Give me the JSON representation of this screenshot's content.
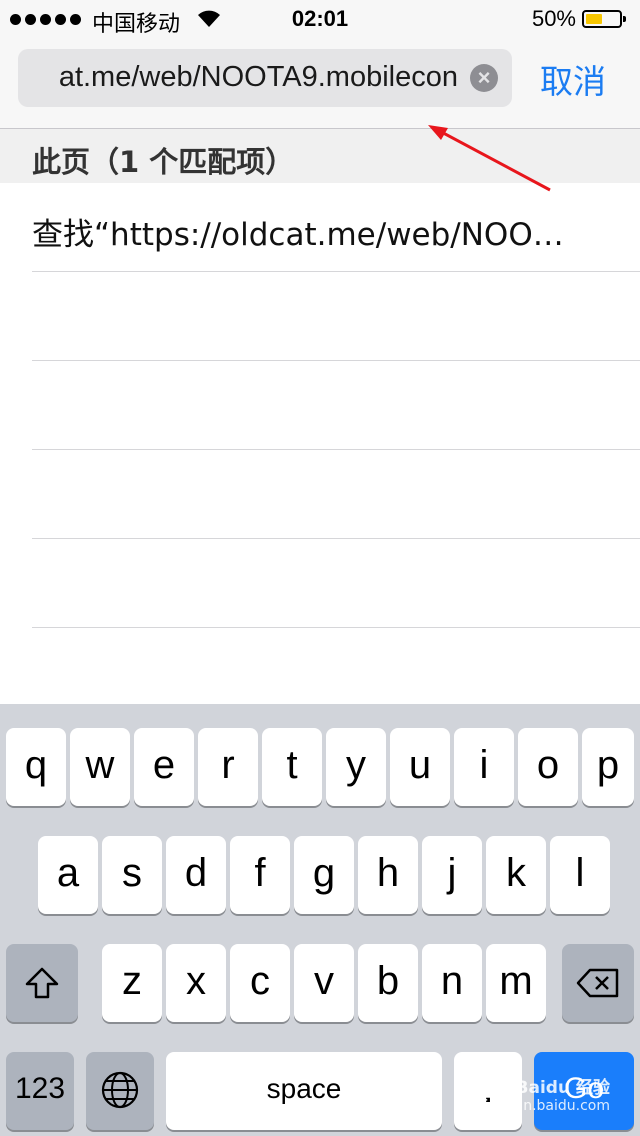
{
  "status_bar": {
    "carrier": "中国移动",
    "time": "02:01",
    "battery_percent": "50%",
    "battery_level": 0.5,
    "battery_color": "#f7c600"
  },
  "search": {
    "url_value": "at.me/web/NOOTA9.mobilecon",
    "clear_icon": "clear-icon",
    "cancel_label": "取消"
  },
  "results": {
    "section_header": "此页（1 个匹配项）",
    "items": [
      "查找“https://oldcat.me/web/NOO…",
      "",
      "",
      "",
      ""
    ]
  },
  "keyboard": {
    "row1": [
      "q",
      "w",
      "e",
      "r",
      "t",
      "y",
      "u",
      "i",
      "o",
      "p"
    ],
    "row2": [
      "a",
      "s",
      "d",
      "f",
      "g",
      "h",
      "j",
      "k",
      "l"
    ],
    "row3": [
      "z",
      "x",
      "c",
      "v",
      "b",
      "n",
      "m"
    ],
    "shift_icon": "shift-icon",
    "delete_icon": "delete-icon",
    "globe_icon": "globe-icon",
    "num_label": "123",
    "space_label": "space",
    "go_label": "Go",
    "accent_color": "#1a7efb"
  },
  "watermark": {
    "line1": "Baidu 经验",
    "line2": "jingyan.baidu.com"
  },
  "annotation": {
    "arrow_color": "#e8161c"
  }
}
